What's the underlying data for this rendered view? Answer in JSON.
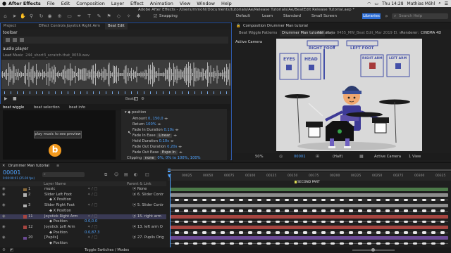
{
  "menubar": {
    "apple_icon": "apple-icon",
    "items": [
      "After Effects",
      "File",
      "Edit",
      "Composition",
      "Layer",
      "Effect",
      "Animation",
      "View",
      "Window",
      "Help"
    ],
    "clock": "Thu 14:28",
    "user": "Mathias Möhl"
  },
  "window": {
    "path": "Adobe After Effects - /Users/mmohl/Documents/tutorials/Ae/Release Tutorials/Ae/BeatEdit Release Tutorial.aep *"
  },
  "toolbar": {
    "snapping_label": "Snapping",
    "workspaces": [
      "Default",
      "Learn",
      "Standard",
      "Small Screen"
    ],
    "active_workspace": "Libraries",
    "search_placeholder": "Search Help"
  },
  "left_panel": {
    "tabs": [
      "Project",
      "Effect Controls Joystick Right Arm",
      "Beat Edit"
    ],
    "toolbar_label": "toolbar",
    "audio_player_label": "audio player",
    "load_music_label": "Load Music",
    "file_name": "244_short3_scratch-that_0059.wav",
    "beats_label": "Beats",
    "sub_tabs": [
      "beat wiggle",
      "beat selection",
      "beat info"
    ],
    "preview_button": "play music to see preview",
    "logo_letter": "b",
    "position_header": "position",
    "props": [
      {
        "label": "Amount",
        "value": "0, 150,0"
      },
      {
        "label": "Return",
        "value": "100%"
      },
      {
        "label": "Fade In Duration",
        "value": "0.10s"
      },
      {
        "label": "Fade In Ease",
        "value": "Linear"
      },
      {
        "label": "Hold Duration",
        "value": "0.10s"
      },
      {
        "label": "Fade Out Duration",
        "value": "0.20s"
      },
      {
        "label": "Fade Out Ease",
        "value": "Expo In"
      }
    ],
    "clipping_label": "Clipping",
    "clipping_value": "none",
    "clipping_extra": "0%, 0% to 100%, 100%"
  },
  "comp_panel": {
    "tabs": [
      "Beat Wiggle Patterns",
      "Drummer Man tutorial",
      "Metadata"
    ],
    "header": "Composition Drummer Man tutorial",
    "active_camera_label": "Active Camera",
    "subtab_file": "Ray - 0455_MW_Beat Edit_Mar 2019 El. v",
    "renderer_label": "Renderer:",
    "renderer_value": "CINEMA 4D",
    "labels": {
      "eyes": "EYES",
      "head": "HEAD",
      "right_foot": "RIGHT FOOT",
      "left_foot": "LEFT FOOT",
      "right_arm": "RIGHT ARM",
      "left_arm": "LEFT ARM"
    },
    "zoom": "50%",
    "timecode": "00001",
    "resolution": "(Half)",
    "camera": "Active Camera",
    "views": "1 View"
  },
  "timeline": {
    "comp_tab": "Drummer Man tutorial",
    "current_time": "00001",
    "time_sub": "0:00:00:01 (25.00 fps)",
    "col_layer_name": "Layer Name",
    "col_parent": "Parent & Link",
    "marker_label": "SECOND PART",
    "ruler_ticks": [
      "00025",
      "00050",
      "00075",
      "00100",
      "00125",
      "00150",
      "00175",
      "00200",
      "00225",
      "00250",
      "00275",
      "00300",
      "00325"
    ],
    "bottom_label": "Toggle Switches / Modes",
    "rows": [
      {
        "num": "1",
        "name": "music",
        "parent": "None",
        "kind": "layer"
      },
      {
        "num": "2",
        "name": "Slider Left Foot",
        "parent": "6. Slider Contr",
        "kind": "layer"
      },
      {
        "num": "",
        "name": "X Position",
        "parent": "",
        "kind": "prop"
      },
      {
        "num": "3",
        "name": "Slider Right Foot",
        "parent": "5. Slider Contr",
        "kind": "layer"
      },
      {
        "num": "",
        "name": "X Position",
        "parent": "",
        "kind": "prop"
      },
      {
        "num": "11",
        "name": "Joystick Right Arm",
        "parent": "15. right arm",
        "kind": "layer"
      },
      {
        "num": "",
        "name": "Position",
        "parent": "",
        "value": "0.0,0.0",
        "kind": "prop"
      },
      {
        "num": "12",
        "name": "Joystick Left Arm",
        "parent": "13. left arm O",
        "kind": "layer"
      },
      {
        "num": "",
        "name": "Position",
        "parent": "",
        "value": "0.0,87.3",
        "kind": "prop"
      },
      {
        "num": "20",
        "name": "[Pupils]",
        "parent": "27. Pupils Orig",
        "kind": "layer"
      },
      {
        "num": "",
        "name": "Position",
        "parent": "",
        "kind": "prop"
      }
    ]
  },
  "colors": {
    "accent_blue": "#2f6fd6",
    "value_blue": "#4fa3ff",
    "diagram_blue": "#4450a8",
    "logo_orange": "#f39a1e",
    "track_green": "#4d7a4a",
    "track_red": "#a64540",
    "track_purple": "#6b4a94"
  }
}
